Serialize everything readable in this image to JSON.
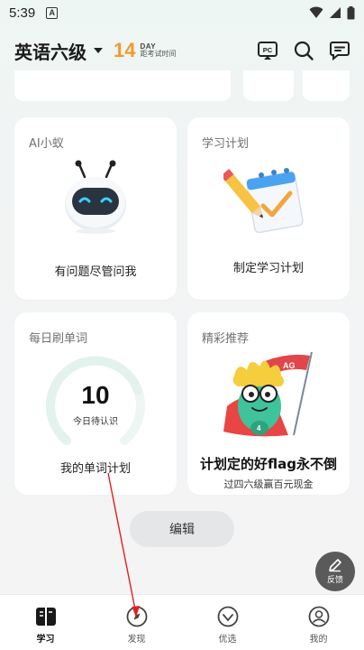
{
  "status_bar": {
    "time": "5:39",
    "notification_icon": "A"
  },
  "header": {
    "exam_name": "英语六级",
    "countdown_number": "14",
    "countdown_unit": "DAY",
    "countdown_desc": "距考试时间",
    "icons": [
      "pc-icon",
      "search-icon",
      "message-icon"
    ]
  },
  "cards": {
    "ai": {
      "title": "AI小蚁",
      "caption": "有问题尽管问我"
    },
    "plan": {
      "title": "学习计划",
      "caption": "制定学习计划"
    },
    "daily_words": {
      "title": "每日刷单词",
      "pending_count": "10",
      "pending_label": "今日待认识",
      "caption": "我的单词计划",
      "ring_progress": 0.75
    },
    "recommend": {
      "title": "精彩推荐",
      "headline": "计划定的好flag永不倒",
      "subline": "过四六级赢百元现金"
    }
  },
  "edit_button": {
    "label": "编辑"
  },
  "feedback_button": {
    "label": "反馈"
  },
  "bottom_nav": {
    "items": [
      {
        "label": "学习",
        "icon": "book-icon",
        "active": true
      },
      {
        "label": "发现",
        "icon": "compass-icon",
        "active": false
      },
      {
        "label": "优选",
        "icon": "diamond-icon",
        "active": false
      },
      {
        "label": "我的",
        "icon": "profile-icon",
        "active": false
      }
    ]
  },
  "colors": {
    "accent_orange": "#f29a2e",
    "ring_track": "#eef6f3",
    "ring_fill": "#e3f2ed",
    "annotation_red": "#e02020"
  }
}
